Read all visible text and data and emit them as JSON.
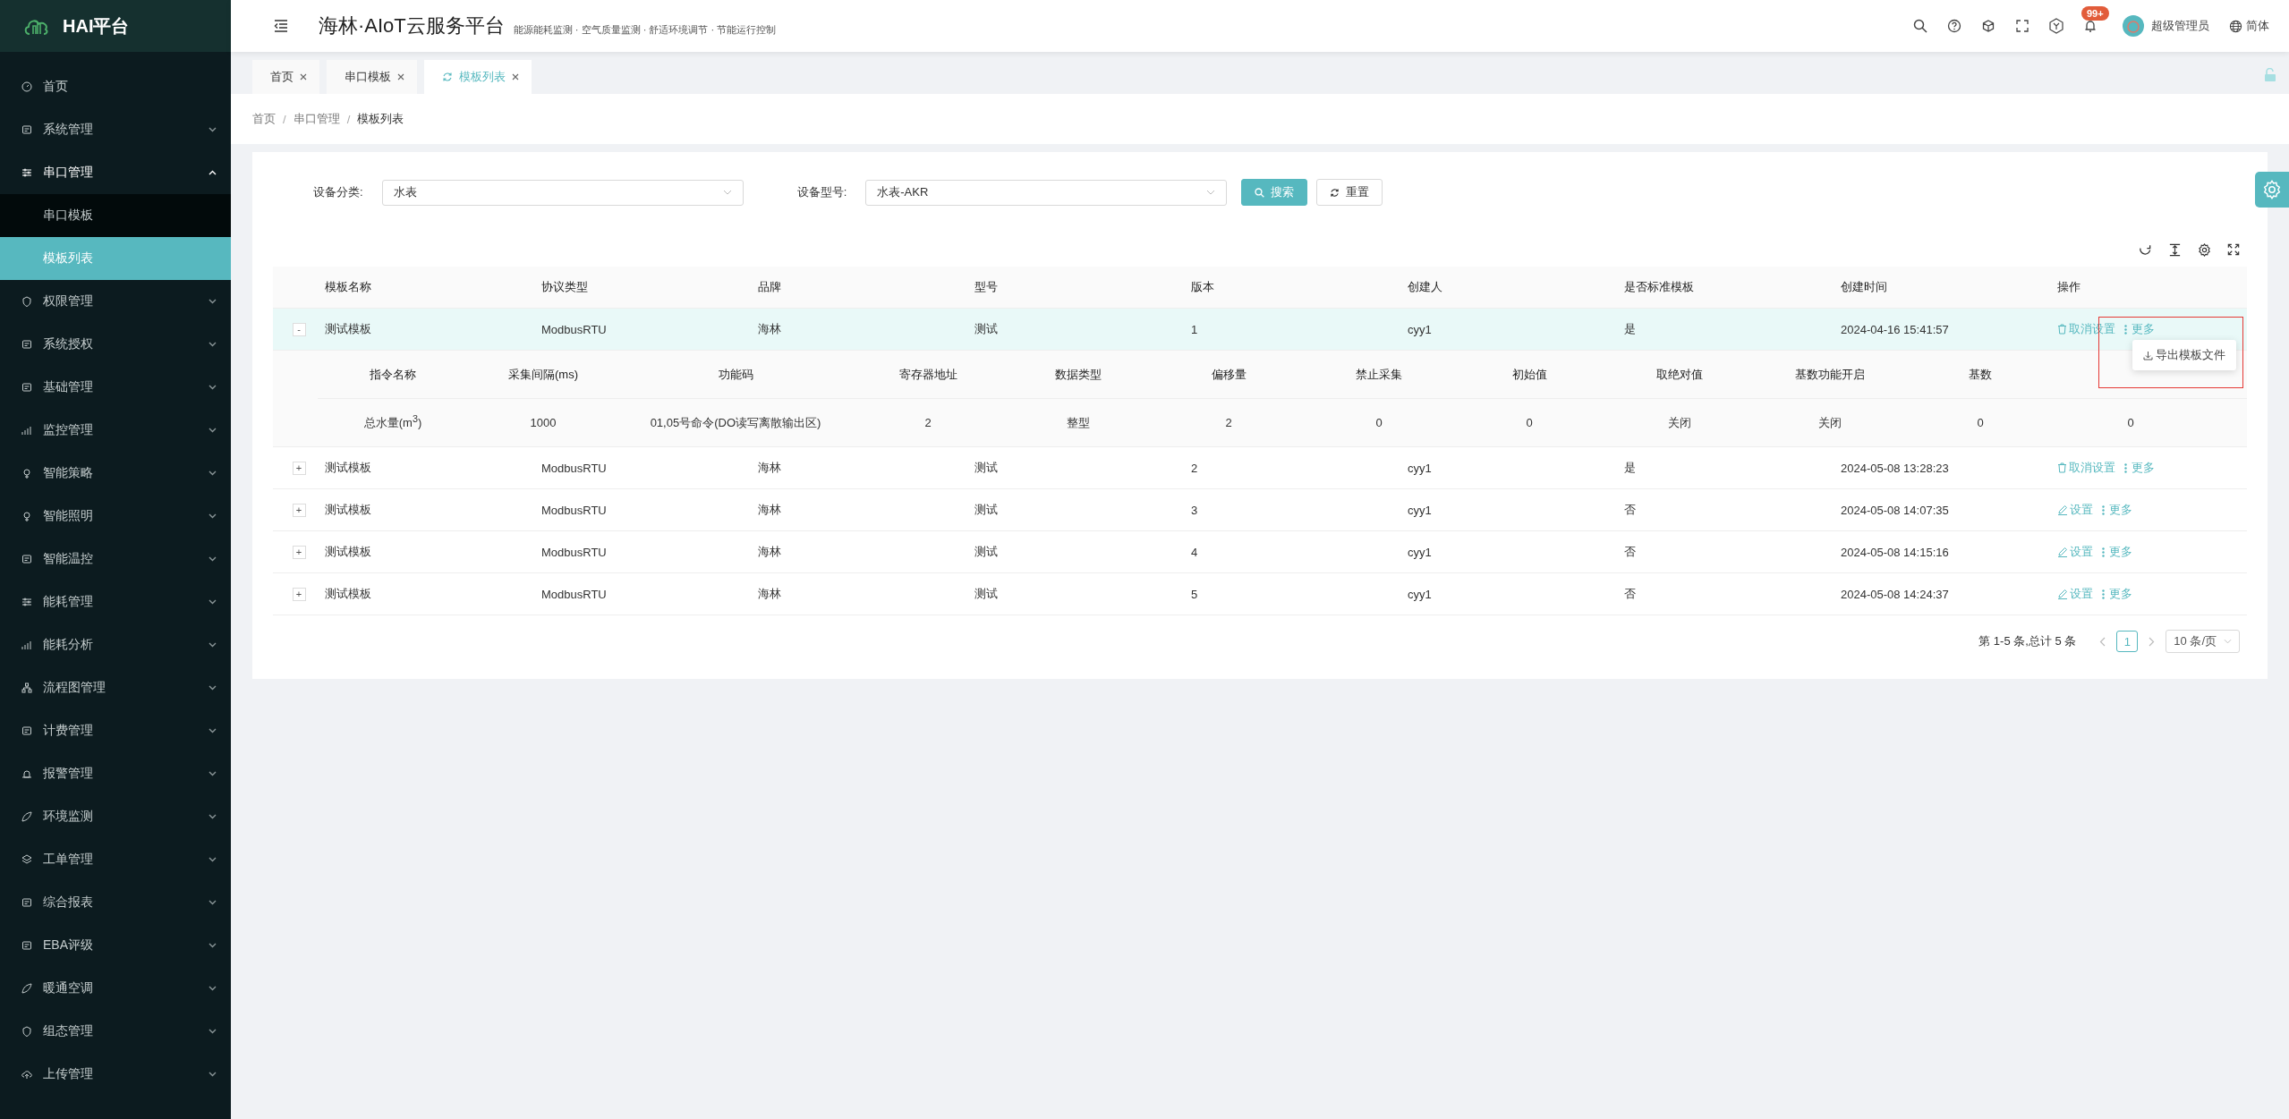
{
  "brand": {
    "name": "HAI平台"
  },
  "sidebar": {
    "items": [
      {
        "label": "首页"
      },
      {
        "label": "系统管理",
        "expanded": false
      },
      {
        "label": "串口管理",
        "expanded": true,
        "children": [
          {
            "label": "串口模板",
            "selected": false
          },
          {
            "label": "模板列表",
            "selected": true
          }
        ]
      },
      {
        "label": "权限管理",
        "expanded": false
      },
      {
        "label": "系统授权",
        "expanded": false
      },
      {
        "label": "基础管理",
        "expanded": false
      },
      {
        "label": "监控管理",
        "expanded": false
      },
      {
        "label": "智能策略",
        "expanded": false
      },
      {
        "label": "智能照明",
        "expanded": false
      },
      {
        "label": "智能温控",
        "expanded": false
      },
      {
        "label": "能耗管理",
        "expanded": false
      },
      {
        "label": "能耗分析",
        "expanded": false
      },
      {
        "label": "流程图管理",
        "expanded": false
      },
      {
        "label": "计费管理",
        "expanded": false
      },
      {
        "label": "报警管理",
        "expanded": false
      },
      {
        "label": "环境监测",
        "expanded": false
      },
      {
        "label": "工单管理",
        "expanded": false
      },
      {
        "label": "综合报表",
        "expanded": false
      },
      {
        "label": "EBA评级",
        "expanded": false
      },
      {
        "label": "暖通空调",
        "expanded": false
      },
      {
        "label": "组态管理",
        "expanded": false
      },
      {
        "label": "上传管理",
        "expanded": false
      }
    ]
  },
  "header": {
    "title": "海林·AIoT云服务平台",
    "subtitle": "能源能耗监测 · 空气质量监测 · 舒适环境调节 · 节能运行控制",
    "badge": "99+",
    "user": "超级管理员",
    "language": "简体"
  },
  "tabs": [
    {
      "label": "首页",
      "selected": false
    },
    {
      "label": "串口模板",
      "selected": false
    },
    {
      "label": "模板列表",
      "selected": true
    }
  ],
  "breadcrumb": {
    "items": [
      "首页",
      "串口管理",
      "模板列表"
    ],
    "separator": "/"
  },
  "filters": [
    {
      "label": "设备分类:",
      "value": "水表"
    },
    {
      "label": "设备型号:",
      "value": "水表-AKR"
    }
  ],
  "buttons": {
    "search": "搜索",
    "reset": "重置"
  },
  "table": {
    "columns": [
      "模板名称",
      "协议类型",
      "品牌",
      "型号",
      "版本",
      "创建人",
      "是否标准模板",
      "创建时间",
      "操作"
    ],
    "rows": [
      {
        "expanded": true,
        "expander": "-",
        "cells": [
          "测试模板",
          "ModbusRTU",
          "海林",
          "测试",
          "1",
          "cyy1",
          "是",
          "2024-04-16 15:41:57"
        ],
        "action": {
          "kind": "cancel",
          "label": "取消设置"
        },
        "more": "更多"
      },
      {
        "expanded": false,
        "expander": "+",
        "cells": [
          "测试模板",
          "ModbusRTU",
          "海林",
          "测试",
          "2",
          "cyy1",
          "是",
          "2024-05-08 13:28:23"
        ],
        "action": {
          "kind": "cancel",
          "label": "取消设置"
        },
        "more": "更多"
      },
      {
        "expanded": false,
        "expander": "+",
        "cells": [
          "测试模板",
          "ModbusRTU",
          "海林",
          "测试",
          "3",
          "cyy1",
          "否",
          "2024-05-08 14:07:35"
        ],
        "action": {
          "kind": "edit",
          "label": "设置"
        },
        "more": "更多"
      },
      {
        "expanded": false,
        "expander": "+",
        "cells": [
          "测试模板",
          "ModbusRTU",
          "海林",
          "测试",
          "4",
          "cyy1",
          "否",
          "2024-05-08 14:15:16"
        ],
        "action": {
          "kind": "edit",
          "label": "设置"
        },
        "more": "更多"
      },
      {
        "expanded": false,
        "expander": "+",
        "cells": [
          "测试模板",
          "ModbusRTU",
          "海林",
          "测试",
          "5",
          "cyy1",
          "否",
          "2024-05-08 14:24:37"
        ],
        "action": {
          "kind": "edit",
          "label": "设置"
        },
        "more": "更多"
      }
    ],
    "detail": {
      "columns": [
        "指令名称",
        "采集间隔(ms)",
        "功能码",
        "寄存器地址",
        "数据类型",
        "偏移量",
        "禁止采集",
        "初始值",
        "取绝对值",
        "基数功能开启",
        "基数"
      ],
      "rows": [
        [
          "总水量(m$^{3}$)",
          "1000",
          "01,05号命令(DO读写离散输出区)",
          "2",
          "整型",
          "2",
          "0",
          "0",
          "关闭",
          "关闭",
          "0",
          "0"
        ]
      ]
    }
  },
  "dropdown": {
    "items": [
      "导出模板文件"
    ]
  },
  "pagination": {
    "summary": "第 1-5 条,总计 5 条",
    "pages": [
      {
        "label": "1",
        "selected": true
      }
    ],
    "page_size": "10 条/页"
  }
}
